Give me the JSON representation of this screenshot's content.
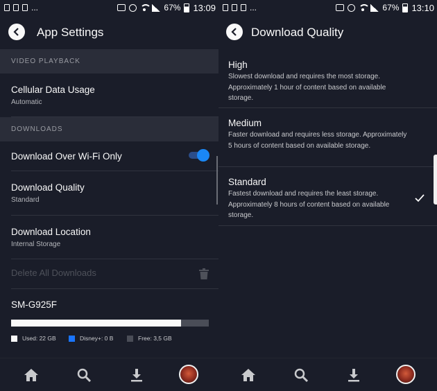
{
  "left": {
    "status": {
      "battery": "67%",
      "time": "13:09",
      "carrier_dots": "..."
    },
    "title": "App Settings",
    "sections": [
      {
        "header": "VIDEO PLAYBACK"
      },
      {
        "header": "DOWNLOADS"
      }
    ],
    "cellular": {
      "title": "Cellular Data Usage",
      "value": "Automatic"
    },
    "wifi_only": {
      "title": "Download Over Wi-Fi Only",
      "enabled": true
    },
    "quality": {
      "title": "Download Quality",
      "value": "Standard"
    },
    "location": {
      "title": "Download Location",
      "value": "Internal Storage"
    },
    "delete_all": {
      "label": "Delete All Downloads"
    },
    "storage": {
      "device": "SM-G925F",
      "used_fraction": 0.86,
      "legend": [
        {
          "label": "Used: 22 GB",
          "color": "#f9f9f9"
        },
        {
          "label": "Disney+: 0 B",
          "color": "#1a75ff"
        },
        {
          "label": "Free: 3,5 GB",
          "color": "#4a4d57"
        }
      ]
    }
  },
  "right": {
    "status": {
      "battery": "67%",
      "time": "13:10",
      "carrier_dots": "..."
    },
    "title": "Download Quality",
    "options": [
      {
        "title": "High",
        "desc": "Slowest download and requires the most storage. Approximately 1 hour of content based on available storage.",
        "selected": false
      },
      {
        "title": "Medium",
        "desc": "Faster download and requires less storage. Approximately 5 hours of content based on available storage.",
        "selected": false
      },
      {
        "title": "Standard",
        "desc": "Fastest download and requires the least storage. Approximately 8 hours of content based on available storage.",
        "selected": true
      }
    ]
  },
  "nav_icons": [
    "home-icon",
    "search-icon",
    "download-icon",
    "profile-avatar"
  ],
  "colors": {
    "background": "#1a1d29",
    "section": "#2a2d39",
    "accent": "#1a87f5"
  }
}
